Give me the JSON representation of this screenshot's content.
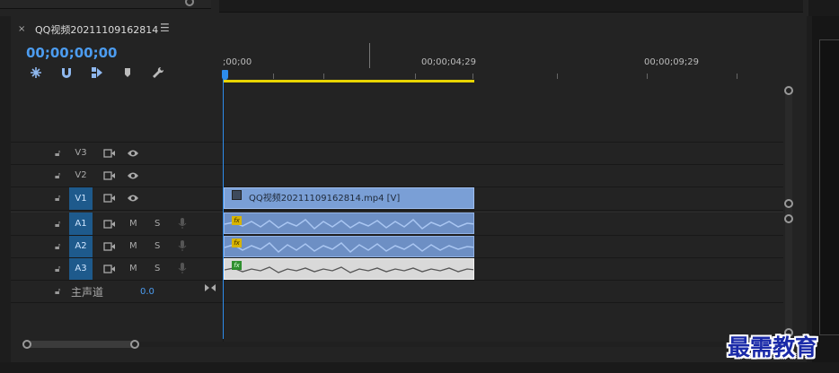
{
  "sequence": {
    "tab_title": "QQ视频20211109162814",
    "close_glyph": "×",
    "menu_glyph": "☰",
    "timecode": "00;00;00;00"
  },
  "ruler": {
    "labels": [
      ";00;00",
      "00;00;04;29",
      "00;00;09;29"
    ]
  },
  "tracks": {
    "video": [
      {
        "name": "V3",
        "targeted": false
      },
      {
        "name": "V2",
        "targeted": false
      },
      {
        "name": "V1",
        "targeted": true
      }
    ],
    "audio": [
      {
        "name": "A1",
        "targeted": true,
        "m": "M",
        "s": "S"
      },
      {
        "name": "A2",
        "targeted": true,
        "m": "M",
        "s": "S"
      },
      {
        "name": "A3",
        "targeted": true,
        "m": "M",
        "s": "S"
      }
    ],
    "master": {
      "label": "主声道",
      "value": "0.0"
    }
  },
  "clips": {
    "video_clip_title": "QQ视频20211109162814.mp4 [V]",
    "fx_label": "fx"
  },
  "watermark": "最需教育",
  "colors": {
    "accent": "#2d8ceb",
    "work_area": "#e8d400",
    "video_clip": "#7a9fd6",
    "audio_clip": "#6d8fc4",
    "selected_audio_clip": "#d9d9d9"
  },
  "icons": {
    "tools": [
      "snap-icon",
      "magnet-icon",
      "linked-selection-icon",
      "marker-icon",
      "wrench-icon"
    ],
    "track_header": [
      "lock-icon",
      "toggle-sync-icon",
      "eye-icon",
      "microphone-icon"
    ]
  }
}
